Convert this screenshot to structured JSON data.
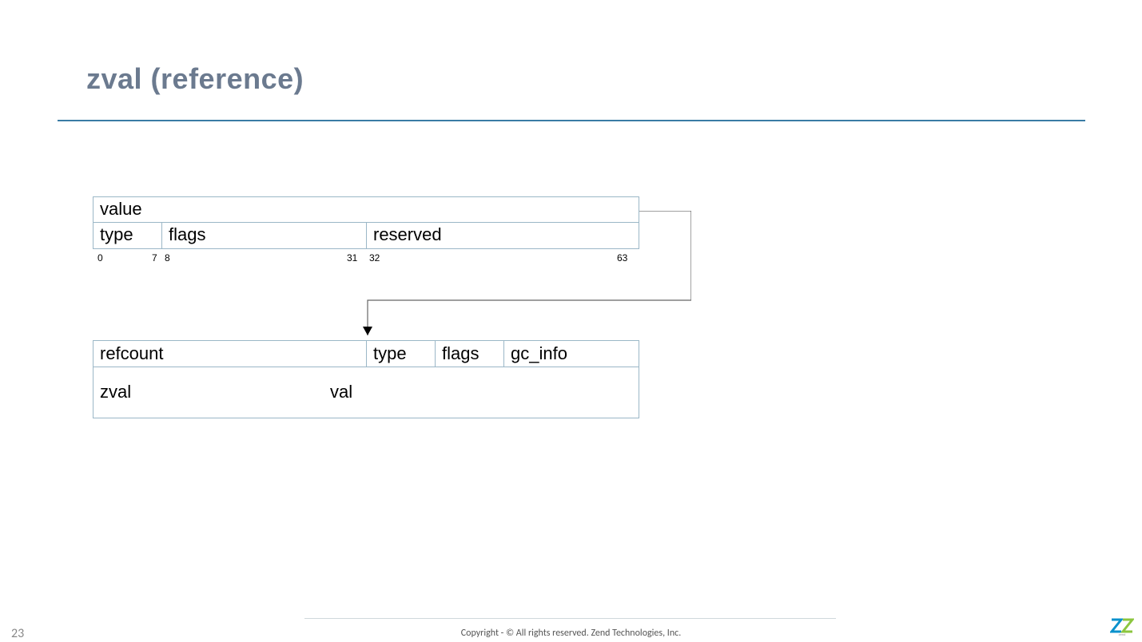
{
  "title": "zval (reference)",
  "top_struct": {
    "row1": "value",
    "row2": {
      "type": "type",
      "flags": "flags",
      "reserved": "reserved"
    },
    "bits": {
      "b0": "0",
      "b7": "7",
      "b8": "8",
      "b31": "31",
      "b32": "32",
      "b63": "63"
    }
  },
  "bottom_struct": {
    "row1": {
      "refcount": "refcount",
      "type": "type",
      "flags": "flags",
      "gc_info": "gc_info"
    },
    "row2": {
      "zval": "zval",
      "val": "val"
    }
  },
  "footer": {
    "copyright": "Copyright - © All rights reserved. Zend Technologies, Inc.",
    "page": "23"
  },
  "logo_text": "zend"
}
